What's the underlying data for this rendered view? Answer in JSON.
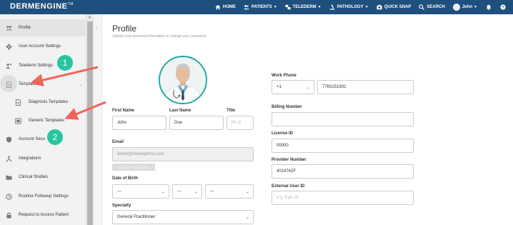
{
  "app": {
    "logo": "DERMENGINE",
    "trademark": "TM"
  },
  "nav": {
    "home": "HOME",
    "patients": "PATIENTS",
    "telederm": "TELEDERM",
    "pathology": "PATHOLOGY",
    "quick_snap": "QUICK SNAP",
    "search": "SEARCH",
    "user": "John"
  },
  "sidebar": {
    "items": [
      {
        "label": "Profile",
        "icon": "users-icon"
      },
      {
        "label": "User Account Settings",
        "icon": "gear-icon"
      },
      {
        "label": "Telederm Settings",
        "icon": "user-group-icon"
      },
      {
        "label": "Templates",
        "icon": "document-icon"
      },
      {
        "label": "Diagnosis Templates",
        "icon": "document-icon"
      },
      {
        "label": "Generic Templates",
        "icon": "image-doc-icon"
      },
      {
        "label": "Account Security",
        "icon": "shield-icon"
      },
      {
        "label": "Integrations",
        "icon": "integration-icon"
      },
      {
        "label": "Clinical Studies",
        "icon": "folder-icon"
      },
      {
        "label": "Routine Followup Settings",
        "icon": "clock-icon"
      },
      {
        "label": "Request to Access Patient",
        "icon": "lock-icon"
      }
    ],
    "visible_labels": [
      "Account Secu"
    ]
  },
  "page": {
    "title": "Profile",
    "subtitle": "Update your personal information or change your password."
  },
  "form": {
    "first_name_label": "First Name",
    "first_name_value": "John",
    "last_name_label": "Last Name",
    "last_name_value": "Doe",
    "title_label": "Title",
    "title_placeholder": "Ph.D",
    "email_label": "Email",
    "email_value": "demo@metaoptima.com",
    "change_password": "CHANGE PASSWORD",
    "dob_label": "Date of Birth",
    "dob_month": "---",
    "dob_day": "---",
    "dob_year": "---",
    "specialty_label": "Specialty",
    "specialty_value": "General Practitioner",
    "work_phone_label": "Work Phone",
    "country_code": "+1",
    "work_phone_value": "7783151902",
    "billing_label": "Billing Number",
    "billing_value": "",
    "license_label": "License ID",
    "license_value": "00000",
    "provider_label": "Provider Number",
    "provider_value": "4024742F",
    "external_label": "External User ID",
    "external_placeholder": "e.g. Epic ID"
  },
  "annotations": {
    "badge_1": "1",
    "badge_2": "2",
    "color": "#27c4a0",
    "arrow_color": "#f0645a"
  },
  "colors": {
    "navbar": "#1f4f7d",
    "accent": "#1fa8a3"
  }
}
